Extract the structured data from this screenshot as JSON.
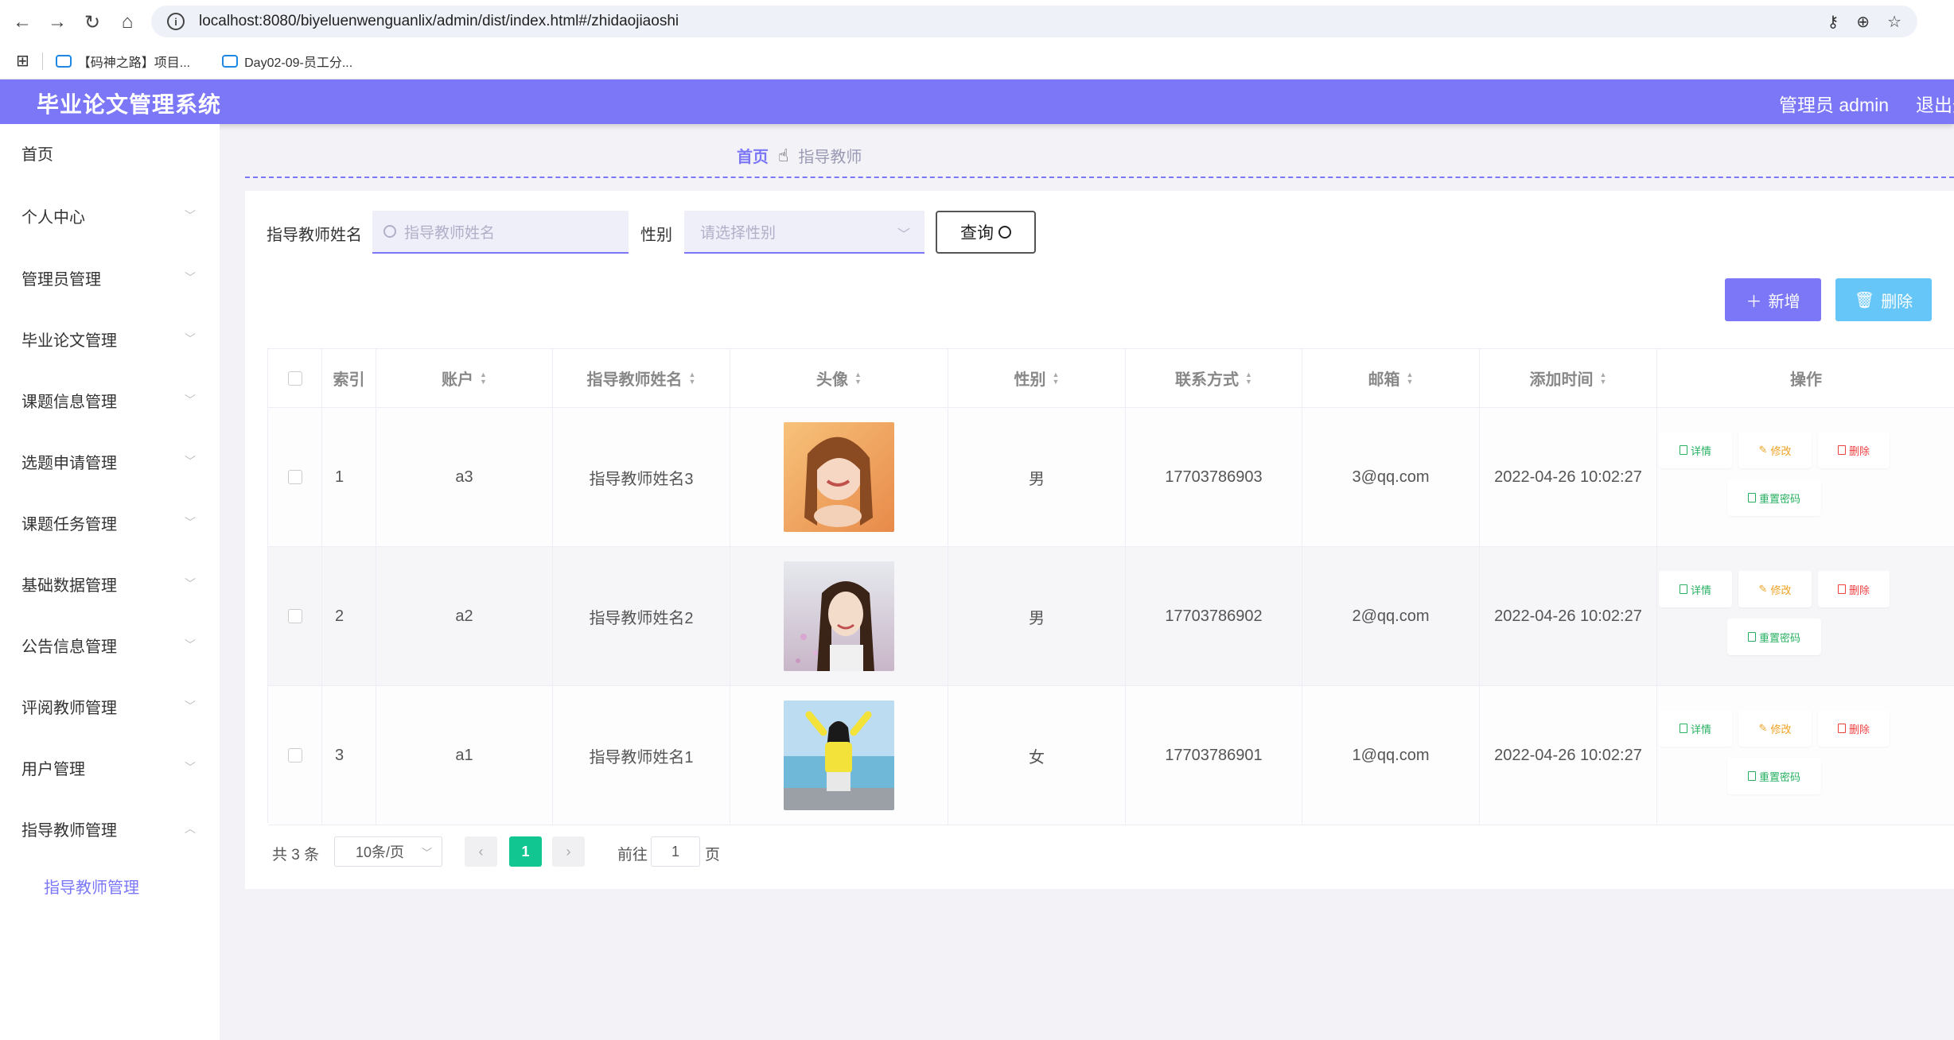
{
  "browser": {
    "url": "localhost:8080/biyeluenwenguanlix/admin/dist/index.html#/zhidaojiaoshi",
    "bookmarks": [
      "【码神之路】项目...",
      "Day02-09-员工分..."
    ]
  },
  "header": {
    "title": "毕业论文管理系统",
    "user": "管理员 admin",
    "logout": "退出登录"
  },
  "sidebar": {
    "items": [
      {
        "label": "首页"
      },
      {
        "label": "个人中心"
      },
      {
        "label": "管理员管理"
      },
      {
        "label": "毕业论文管理"
      },
      {
        "label": "课题信息管理"
      },
      {
        "label": "选题申请管理"
      },
      {
        "label": "课题任务管理"
      },
      {
        "label": "基础数据管理"
      },
      {
        "label": "公告信息管理"
      },
      {
        "label": "评阅教师管理"
      },
      {
        "label": "用户管理"
      },
      {
        "label": "指导教师管理"
      }
    ],
    "sub_item": "指导教师管理"
  },
  "breadcrumb": {
    "home": "首页",
    "current": "指导教师"
  },
  "search": {
    "name_label": "指导教师姓名",
    "name_placeholder": "指导教师姓名",
    "gender_label": "性别",
    "gender_placeholder": "请选择性别",
    "query_label": "查询"
  },
  "actions": {
    "add": "新增",
    "delete": "删除"
  },
  "table": {
    "headers": [
      "索引",
      "账户",
      "指导教师姓名",
      "头像",
      "性别",
      "联系方式",
      "邮箱",
      "添加时间",
      "操作"
    ],
    "rows": [
      {
        "index": "1",
        "account": "a3",
        "name": "指导教师姓名3",
        "gender": "男",
        "phone": "17703786903",
        "email": "3@qq.com",
        "time": "2022-04-26 10:02:27"
      },
      {
        "index": "2",
        "account": "a2",
        "name": "指导教师姓名2",
        "gender": "男",
        "phone": "17703786902",
        "email": "2@qq.com",
        "time": "2022-04-26 10:02:27"
      },
      {
        "index": "3",
        "account": "a1",
        "name": "指导教师姓名1",
        "gender": "女",
        "phone": "17703786901",
        "email": "1@qq.com",
        "time": "2022-04-26 10:02:27"
      }
    ],
    "ops": {
      "detail": "详情",
      "edit": "修改",
      "delete": "删除",
      "reset": "重置密码"
    }
  },
  "pagination": {
    "total": "共 3 条",
    "page_size": "10条/页",
    "current_page": "1",
    "goto_label": "前往",
    "goto_value": "1",
    "page_suffix": "页"
  },
  "colors": {
    "primary": "#7b77f7",
    "delete_button": "#66c6f7",
    "pager_active": "#11c690"
  }
}
